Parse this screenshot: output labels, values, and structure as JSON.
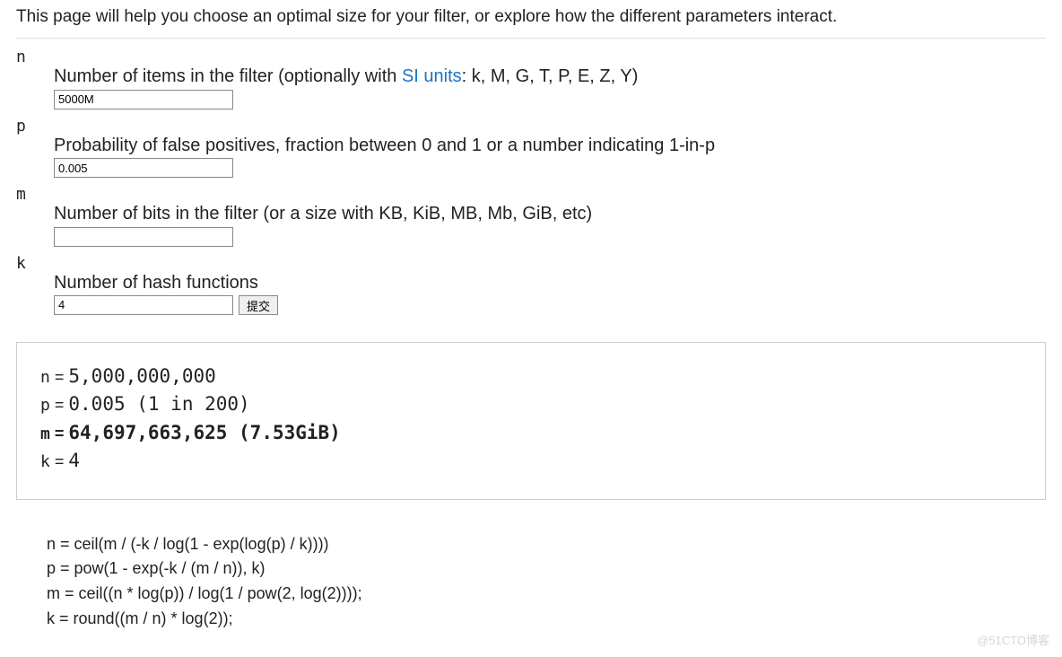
{
  "intro": "This page will help you choose an optimal size for your filter, or explore how the different parameters interact.",
  "params": {
    "n": {
      "var": "n",
      "label_pre": "Number of items in the filter (optionally with ",
      "si_link": "SI units",
      "label_post": ": k, M, G, T, P, E, Z, Y)",
      "value": "5000M"
    },
    "p": {
      "var": "p",
      "label": "Probability of false positives, fraction between 0 and 1 or a number indicating 1-in-p",
      "value": "0.005"
    },
    "m": {
      "var": "m",
      "label": "Number of bits in the filter (or a size with KB, KiB, MB, Mb, GiB, etc)",
      "value": ""
    },
    "k": {
      "var": "k",
      "label": "Number of hash functions",
      "value": "4"
    }
  },
  "submit_label": "提交",
  "results": {
    "n": {
      "var": "n",
      "eq": "=",
      "val": "5,000,000,000"
    },
    "p": {
      "var": "p",
      "eq": "=",
      "val": "0.005 (1 in 200)"
    },
    "m": {
      "var": "m",
      "eq": "=",
      "val": "64,697,663,625 (7.53GiB)"
    },
    "k": {
      "var": "k",
      "eq": "=",
      "val": "4"
    }
  },
  "formulas": {
    "n": "n = ceil(m / (-k / log(1 - exp(log(p) / k))))",
    "p": "p = pow(1 - exp(-k / (m / n)), k)",
    "m": "m = ceil((n * log(p)) / log(1 / pow(2, log(2))));",
    "k": "k = round((m / n) * log(2));"
  },
  "watermark": "@51CTO博客"
}
